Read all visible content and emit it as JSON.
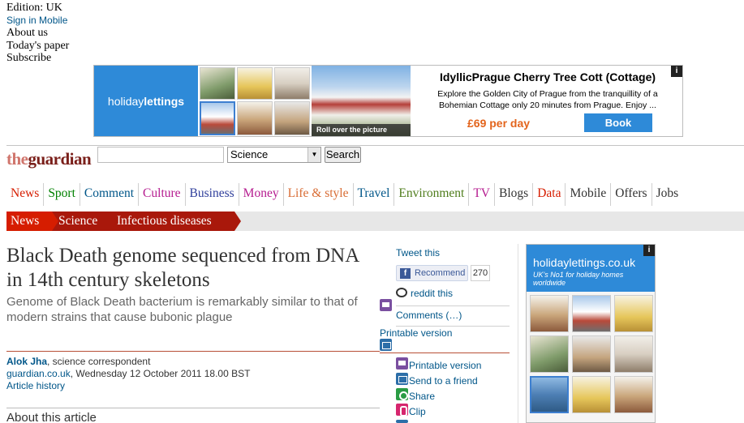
{
  "top_meta": {
    "edition": "Edition: UK",
    "sign_in": "Sign in Mobile",
    "about": "About us",
    "todays_paper": "Today's paper",
    "subscribe": "Subscribe"
  },
  "ad_top": {
    "brand_prefix": "holiday",
    "brand_suffix": "lettings",
    "caption": "Roll over the picture",
    "title": "IdyllicPrague Cherry Tree Cott (Cottage)",
    "description": "Explore the Golden City of Prague from the tranquillity of a Bohemian Cottage only 20 minutes from Prague. Enjoy ...",
    "price": "£69 per day",
    "book_label": "Book",
    "info": "i"
  },
  "header": {
    "logo_the": "the",
    "logo_guardian": "guardian",
    "search_select_value": "Science",
    "search_button": "Search"
  },
  "nav": {
    "items": [
      {
        "label": "News",
        "color": "#d61d00"
      },
      {
        "label": "Sport",
        "color": "#008000"
      },
      {
        "label": "Comment",
        "color": "#005689"
      },
      {
        "label": "Culture",
        "color": "#b51b8f"
      },
      {
        "label": "Business",
        "color": "#2f3e9b"
      },
      {
        "label": "Money",
        "color": "#b51b8f"
      },
      {
        "label": "Life & style",
        "color": "#d86c34"
      },
      {
        "label": "Travel",
        "color": "#005689"
      },
      {
        "label": "Environment",
        "color": "#4f7d1c"
      },
      {
        "label": "TV",
        "color": "#b51b8f"
      },
      {
        "label": "Blogs",
        "color": "#333333"
      },
      {
        "label": "Data",
        "color": "#d61d00"
      },
      {
        "label": "Mobile",
        "color": "#333333"
      },
      {
        "label": "Offers",
        "color": "#333333"
      },
      {
        "label": "Jobs",
        "color": "#333333"
      }
    ]
  },
  "breadcrumb": {
    "items": [
      "News",
      "Science",
      "Infectious diseases"
    ]
  },
  "article": {
    "headline": "Black Death genome sequenced from DNA in 14th century skeletons",
    "standfirst": "Genome of Black Death bacterium is remarkably similar to that of modern strains that cause bubonic plague",
    "author": "Alok Jha",
    "author_role": ", science correspondent",
    "source": "guardian.co.uk",
    "date": ", Wednesday 12 October 2011 18.00 BST",
    "history": "Article history",
    "about": "About this article"
  },
  "share": {
    "tweet": "Tweet this",
    "fb_label": "Recommend",
    "fb_count": "270",
    "reddit": "reddit this",
    "comments": "Comments (…)",
    "printable_top": "Printable version"
  },
  "tools": {
    "printable": "Printable version",
    "send": "Send to a friend",
    "share": "Share",
    "clip": "Clip"
  },
  "ad_side": {
    "name": "holidaylettings.co.uk",
    "tagline": "UK's No1 for holiday homes worldwide",
    "info": "i"
  }
}
